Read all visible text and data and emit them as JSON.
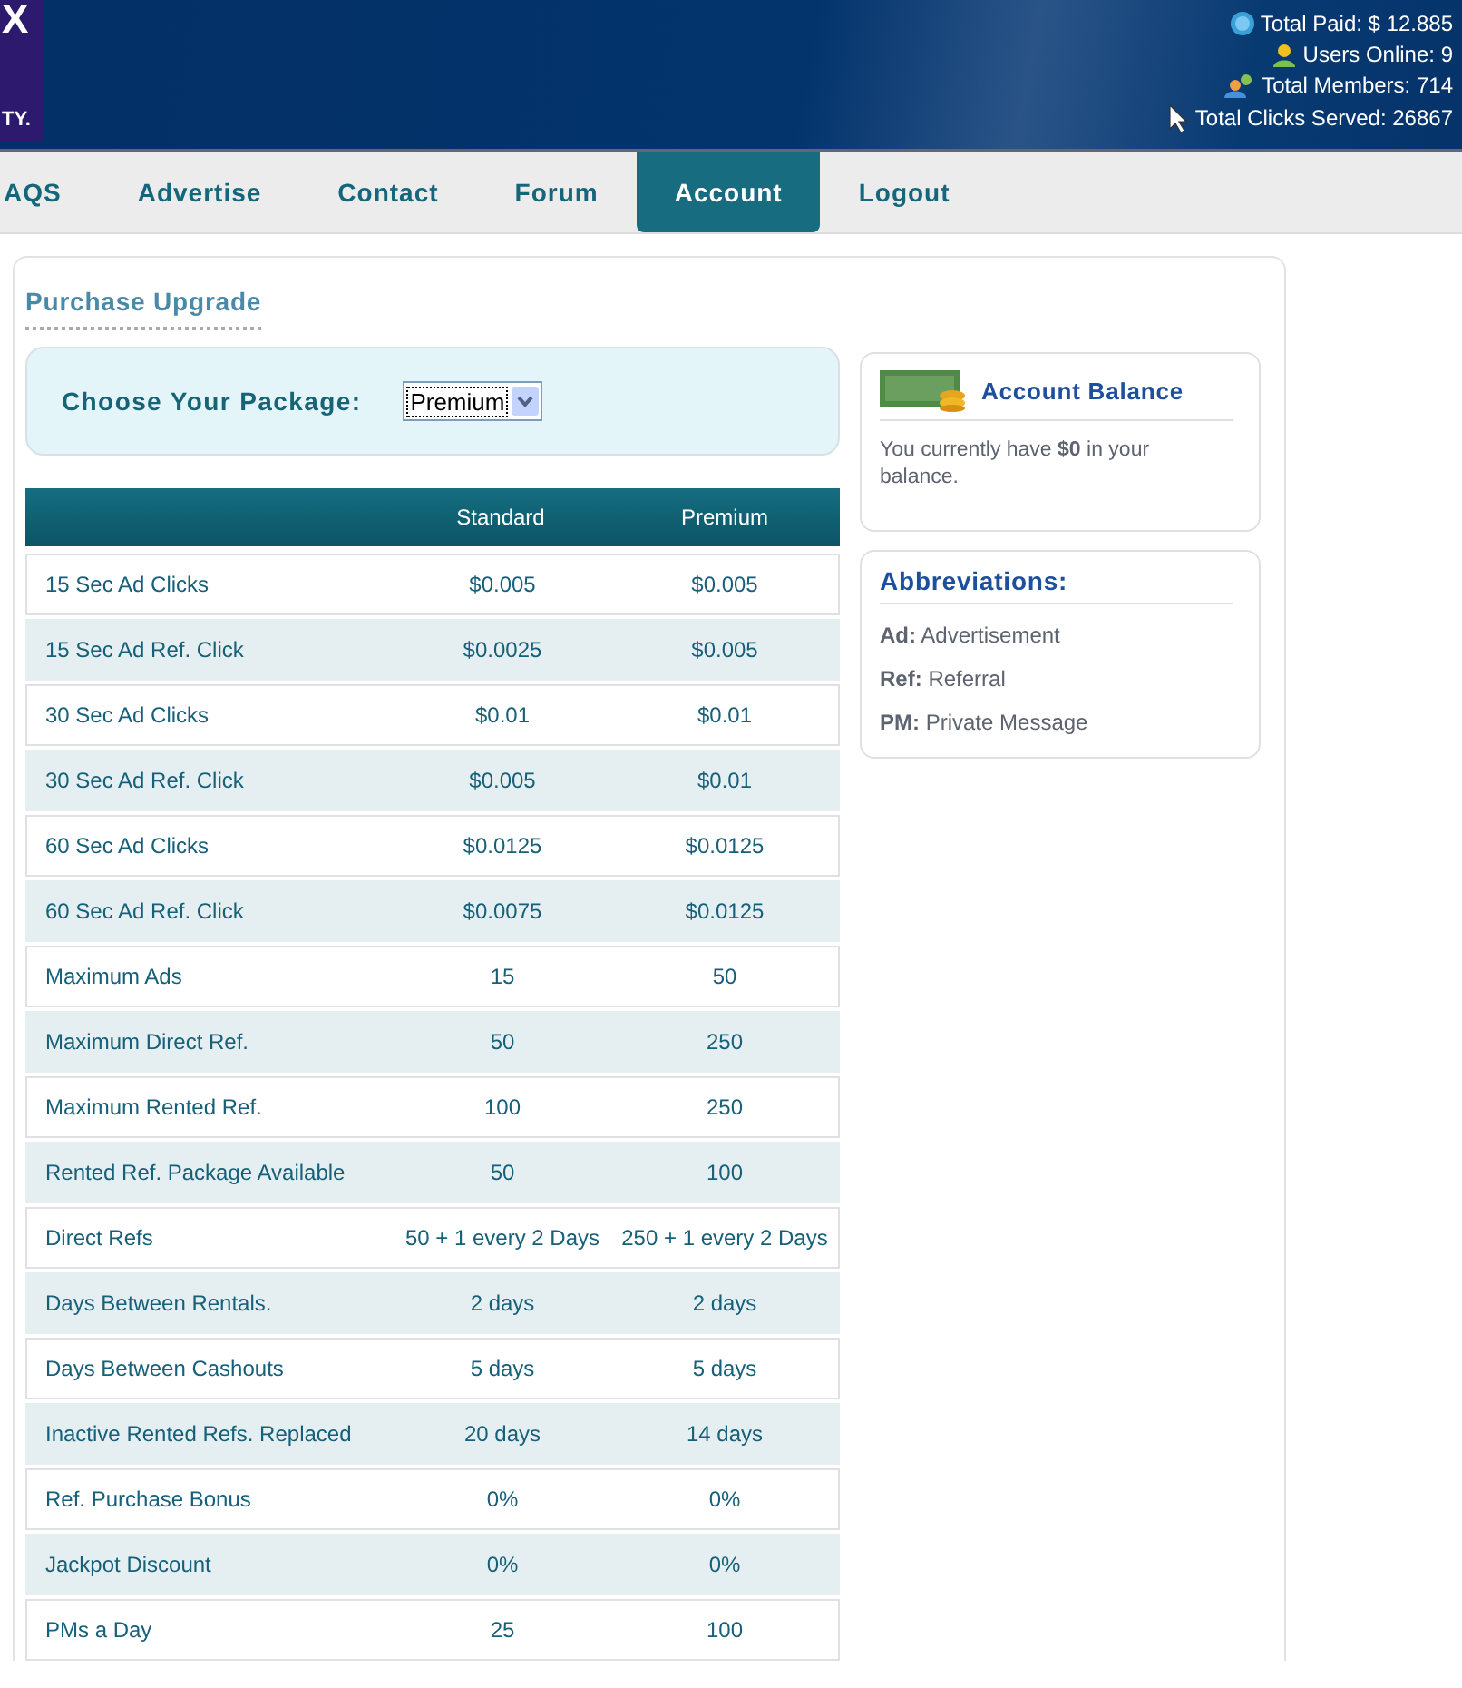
{
  "logo": {
    "lines": [
      "X",
      "TY."
    ]
  },
  "stats": [
    {
      "kind": "coin",
      "text": "Total Paid: $ 12.885"
    },
    {
      "kind": "user",
      "text": "Users Online: 9"
    },
    {
      "kind": "users",
      "text": "Total Members: 714"
    },
    {
      "kind": "cursor",
      "text": "Total Clicks Served: 26867"
    }
  ],
  "nav": [
    {
      "label": "AQS",
      "selected": false
    },
    {
      "label": "Advertise",
      "selected": false
    },
    {
      "label": "Contact",
      "selected": false
    },
    {
      "label": "Forum",
      "selected": false
    },
    {
      "label": "Account",
      "selected": true
    },
    {
      "label": "Logout",
      "selected": false
    }
  ],
  "section_title": "Purchase Upgrade",
  "package": {
    "label": "Choose Your Package:",
    "value": "Premium"
  },
  "table": {
    "columns": [
      "",
      "Standard",
      "Premium"
    ],
    "rows": [
      [
        "15 Sec Ad Clicks",
        "$0.005",
        "$0.005"
      ],
      [
        "15 Sec Ad Ref. Click",
        "$0.0025",
        "$0.005"
      ],
      [
        "30 Sec Ad Clicks",
        "$0.01",
        "$0.01"
      ],
      [
        "30 Sec Ad Ref. Click",
        "$0.005",
        "$0.01"
      ],
      [
        "60 Sec Ad Clicks",
        "$0.0125",
        "$0.0125"
      ],
      [
        "60 Sec Ad Ref. Click",
        "$0.0075",
        "$0.0125"
      ],
      [
        "Maximum Ads",
        "15",
        "50"
      ],
      [
        "Maximum Direct Ref.",
        "50",
        "250"
      ],
      [
        "Maximum Rented Ref.",
        "100",
        "250"
      ],
      [
        "Rented Ref. Package Available",
        "50",
        "100"
      ],
      [
        "Direct Refs",
        "50 + 1 every 2 Days",
        "250 + 1 every 2 Days"
      ],
      [
        "Days Between Rentals.",
        "2 days",
        "2 days"
      ],
      [
        "Days Between Cashouts",
        "5 days",
        "5 days"
      ],
      [
        "Inactive Rented Refs. Replaced",
        "20 days",
        "14 days"
      ],
      [
        "Ref. Purchase Bonus",
        "0%",
        "0%"
      ],
      [
        "Jackpot Discount",
        "0%",
        "0%"
      ],
      [
        "PMs a Day",
        "25",
        "100"
      ]
    ]
  },
  "balance": {
    "title": "Account Balance",
    "text": "You currently have **$0** in your balance."
  },
  "abbreviations": {
    "title": "Abbreviations:",
    "items": [
      {
        "term": "Ad:",
        "meaning": "Advertisement"
      },
      {
        "term": "Ref:",
        "meaning": "Referral"
      },
      {
        "term": "PM:",
        "meaning": "Private Message"
      }
    ]
  }
}
